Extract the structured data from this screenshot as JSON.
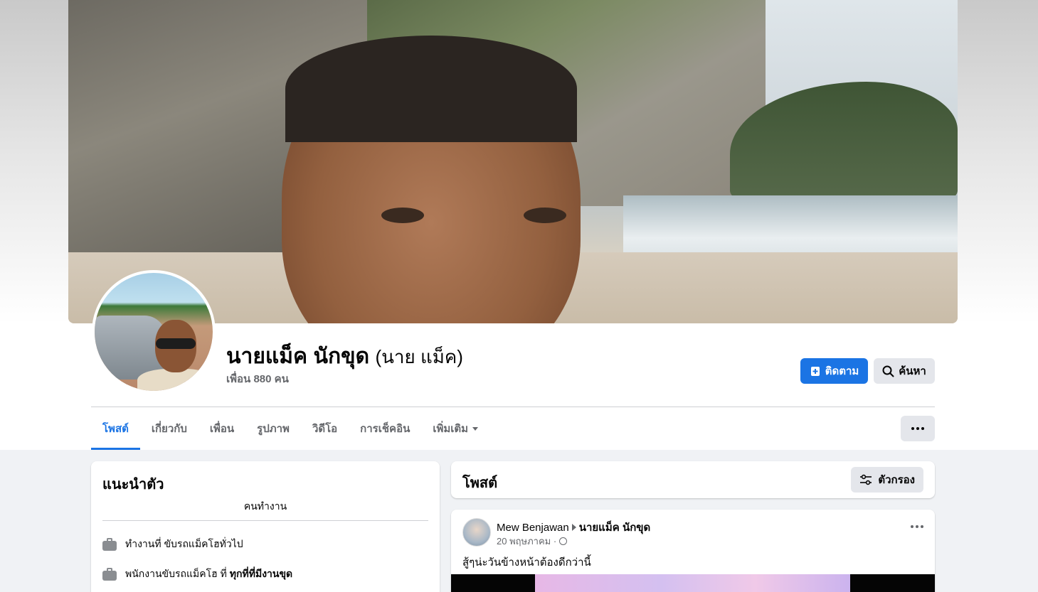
{
  "profile": {
    "name": "นายแม็ค นักขุด",
    "alt_name": "(นาย แม็ค)",
    "friends": "เพื่อน 880 คน",
    "follow_label": "ติดตาม",
    "search_label": "ค้นหา"
  },
  "tabs": [
    {
      "label": "โพสต์",
      "active": true
    },
    {
      "label": "เกี่ยวกับ",
      "active": false
    },
    {
      "label": "เพื่อน",
      "active": false
    },
    {
      "label": "รูปภาพ",
      "active": false
    },
    {
      "label": "วิดีโอ",
      "active": false
    },
    {
      "label": "การเช็คอิน",
      "active": false
    },
    {
      "label": "เพิ่มเติม",
      "active": false
    }
  ],
  "intro": {
    "title": "แนะนำตัว",
    "bio": "คนทำงาน",
    "work_1": "ทำงานที่ ขับรถแม็คโฮทั่วไป",
    "work_2_prefix": "พนักงานขับรถแม็คโฮ ที่",
    "work_2_place": "ทุกที่ที่มีงานขุด"
  },
  "posts_header": {
    "title": "โพสต์",
    "filter_label": "ตัวกรอง"
  },
  "post": {
    "author": "Mew Benjawan",
    "target": "นายแม็ค นักขุด",
    "date": "20 พฤษภาคม ·",
    "text": "สู้ๆน่ะวันข้างหน้าต้องดีกว่านี้"
  },
  "colors": {
    "accent": "#1b74e4",
    "background": "#f0f2f5"
  }
}
